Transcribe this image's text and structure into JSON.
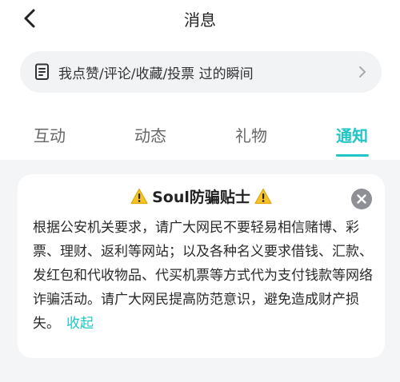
{
  "header": {
    "title": "消息"
  },
  "interaction": {
    "label": "我点赞/评论/收藏/投票 过的瞬间"
  },
  "tabs": [
    {
      "label": "互动"
    },
    {
      "label": "动态"
    },
    {
      "label": "礼物"
    },
    {
      "label": "通知"
    }
  ],
  "active_tab": "通知",
  "notice": {
    "title": "Soul防骗贴士",
    "body": "根据公安机关要求，请广大网民不要轻易相信赌博、彩票、理财、返利等网站；以及各种名义要求借钱、汇款、发红包和代收物品、代买机票等方式代为支付钱款等网络诈骗活动。请广大网民提高防范意识，避免造成财产损失。",
    "collapse_label": "收起"
  },
  "colors": {
    "accent": "#20c5c7",
    "warning": "#f5c22c"
  },
  "icons": {
    "back": "chevron-left-icon",
    "document": "document-icon",
    "forward": "chevron-right-icon",
    "warning": "warning-icon",
    "close": "close-icon"
  }
}
